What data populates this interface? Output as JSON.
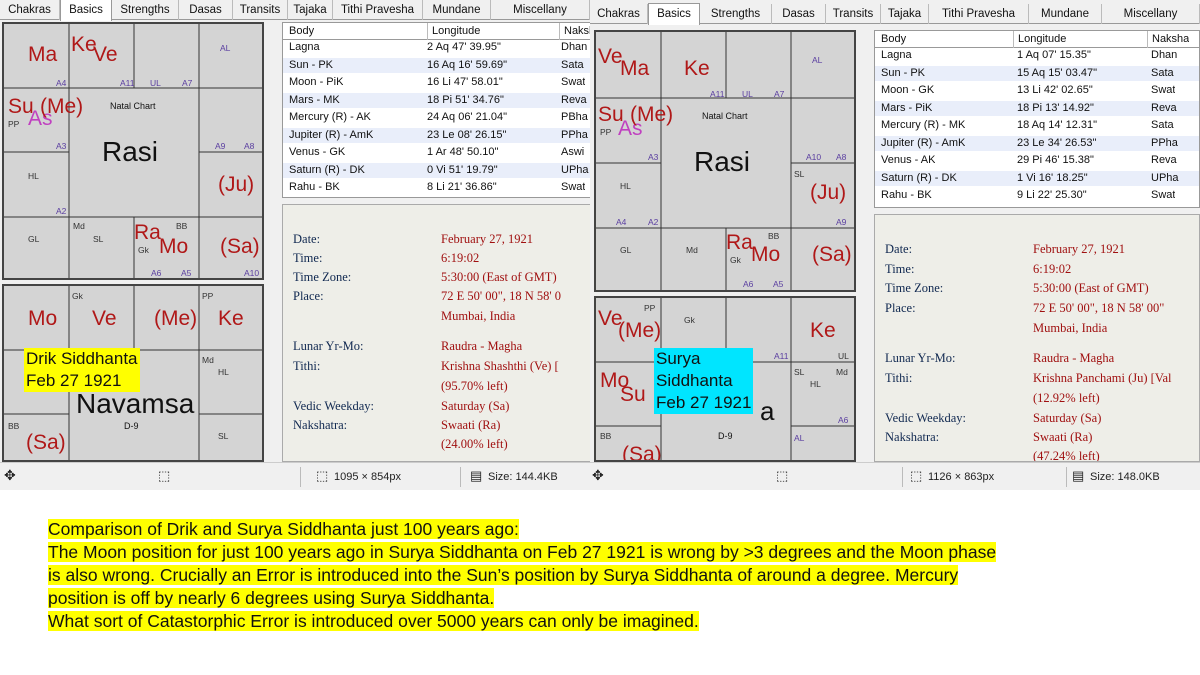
{
  "tabs_left": [
    "Chakras",
    "Basics",
    "Strengths",
    "Dasas",
    "Transits",
    "Tajaka",
    "Tithi Pravesha",
    "Mundane",
    "Miscellany"
  ],
  "tabs_right": [
    "Chakras",
    "Basics",
    "Strengths",
    "Dasas",
    "Transits",
    "Tajaka",
    "Tithi Pravesha",
    "Mundane",
    "Miscellany"
  ],
  "active_tab": "Basics",
  "colors": {
    "planet": "#b01818",
    "ascendant": "#c040c0",
    "label_left": "#ffff00",
    "label_right": "#00e5ff",
    "chart_bg": "#d4d4d4"
  },
  "left": {
    "rasi": {
      "name": "Rasi",
      "sub": "Natal Chart",
      "planets": [
        "Ma",
        "Ke",
        "Ve",
        "Su",
        "As",
        "(Me)",
        "(Ju)",
        "Ra",
        "Mo",
        "(Sa)"
      ],
      "small": [
        "AL",
        "A4",
        "A11",
        "UL",
        "A7",
        "PP",
        "A3",
        "A9",
        "A8",
        "HL",
        "A2",
        "Md",
        "SL",
        "BB",
        "GL",
        "Gk",
        "A6",
        "A5",
        "A10"
      ]
    },
    "navamsa": {
      "name": "Navamsa",
      "sub": "D-9",
      "planets": [
        "Mo",
        "Ve",
        "(Me)",
        "Ke",
        "(Sa)"
      ],
      "small": [
        "Gk",
        "PP",
        "Md",
        "HL",
        "SL",
        "BB"
      ]
    },
    "label": [
      "Drik Siddhanta",
      "Feb 27 1921"
    ],
    "table": {
      "headers": [
        "Body",
        "Longitude",
        "Naksh"
      ],
      "rows": [
        [
          "Lagna",
          "2 Aq 47' 39.95\"",
          "Dhan"
        ],
        [
          "Sun - PK",
          "16 Aq 16' 59.69\"",
          "Sata"
        ],
        [
          "Moon - PiK",
          "16 Li 47' 58.01\"",
          "Swat"
        ],
        [
          "Mars - MK",
          "18 Pi 51' 34.76\"",
          "Reva"
        ],
        [
          "Mercury (R) - AK",
          "24 Aq 06' 21.04\"",
          "PBha"
        ],
        [
          "Jupiter (R) - AmK",
          "23 Le 08' 26.15\"",
          "PPha"
        ],
        [
          "Venus - GK",
          "1 Ar 48' 50.10\"",
          "Aswi"
        ],
        [
          "Saturn (R) - DK",
          "0 Vi 51' 19.79\"",
          "UPha"
        ],
        [
          "Rahu - BK",
          "8 Li 21' 36.86\"",
          "Swat"
        ]
      ]
    },
    "details": [
      [
        "Date:",
        "February 27, 1921"
      ],
      [
        "Time:",
        "6:19:02"
      ],
      [
        "Time Zone:",
        "5:30:00 (East of GMT)"
      ],
      [
        "Place:",
        "72 E 50' 00\", 18 N 58' 0"
      ],
      [
        "",
        "Mumbai, India"
      ],
      [
        "Lunar Yr-Mo:",
        "Raudra - Magha"
      ],
      [
        "Tithi:",
        "Krishna Shashthi (Ve) ["
      ],
      [
        "",
        "(95.70% left)"
      ],
      [
        "Vedic Weekday:",
        "Saturday (Sa)"
      ],
      [
        "Nakshatra:",
        "Swaati (Ra)"
      ],
      [
        "",
        "(24.00% left)"
      ]
    ],
    "status": {
      "dims": "1095 × 854px",
      "size": "Size: 144.4KB"
    }
  },
  "right": {
    "rasi": {
      "name": "Rasi",
      "sub": "Natal Chart",
      "planets": [
        "Ve",
        "Ma",
        "Ke",
        "Su",
        "As",
        "(Me)",
        "(Ju)",
        "Ra",
        "Mo",
        "(Sa)"
      ],
      "small": [
        "AL",
        "A11",
        "UL",
        "A7",
        "PP",
        "A3",
        "A10",
        "A8",
        "HL",
        "SL",
        "A9",
        "A4",
        "A2",
        "GL",
        "Md",
        "BB",
        "Gk",
        "A6",
        "A5"
      ]
    },
    "navamsa": {
      "name": "Navamsa",
      "sub": "D-9",
      "planets": [
        "Ve",
        "(Me)",
        "Ke",
        "Mo",
        "Su",
        "(Sa)"
      ],
      "small": [
        "PP",
        "Gk",
        "A11",
        "UL",
        "SL",
        "Md",
        "HL",
        "A6",
        "BB",
        "AL"
      ]
    },
    "label": [
      "Surya",
      "Siddhanta",
      "Feb 27 1921"
    ],
    "table": {
      "headers": [
        "Body",
        "Longitude",
        "Naksha"
      ],
      "rows": [
        [
          "Lagna",
          "1 Aq 07' 15.35\"",
          "Dhan"
        ],
        [
          "Sun - PK",
          "15 Aq 15' 03.47\"",
          "Sata"
        ],
        [
          "Moon - GK",
          "13 Li 42' 02.65\"",
          "Swat"
        ],
        [
          "Mars - PiK",
          "18 Pi 13' 14.92\"",
          "Reva"
        ],
        [
          "Mercury (R) - MK",
          "18 Aq 14' 12.31\"",
          "Sata"
        ],
        [
          "Jupiter (R) - AmK",
          "23 Le 34' 26.53\"",
          "PPha"
        ],
        [
          "Venus - AK",
          "29 Pi 46' 15.38\"",
          "Reva"
        ],
        [
          "Saturn (R) - DK",
          "1 Vi 16' 18.25\"",
          "UPha"
        ],
        [
          "Rahu - BK",
          "9 Li 22' 25.30\"",
          "Swat"
        ]
      ]
    },
    "details": [
      [
        "Date:",
        "February 27, 1921"
      ],
      [
        "Time:",
        "6:19:02"
      ],
      [
        "Time Zone:",
        "5:30:00 (East of GMT)"
      ],
      [
        "Place:",
        "72 E 50' 00\", 18 N 58' 00\""
      ],
      [
        "",
        "Mumbai, India"
      ],
      [
        "Lunar Yr-Mo:",
        "Raudra - Magha"
      ],
      [
        "Tithi:",
        "Krishna Panchami (Ju) [Val"
      ],
      [
        "",
        "(12.92% left)"
      ],
      [
        "Vedic Weekday:",
        "Saturday (Sa)"
      ],
      [
        "Nakshatra:",
        "Swaati (Ra)"
      ],
      [
        "",
        "(47.24% left)"
      ]
    ],
    "status": {
      "dims": "1126 × 863px",
      "size": "Size: 148.0KB"
    }
  },
  "note_lines": [
    "Comparison of Drik and Surya Siddhanta just 100 years ago:",
    "The Moon position for just 100 years ago in Surya Siddhanta on Feb 27 1921 is wrong by >3 degrees and the Moon phase",
    "is also wrong. Crucially an Error is introduced into the Sun’s position by Surya Siddhanta of around a degree. Mercury",
    "position is off by nearly 6 degrees using Surya Siddhanta.",
    "What sort of Catastorphic Error is introduced over 5000 years can only be imagined."
  ]
}
